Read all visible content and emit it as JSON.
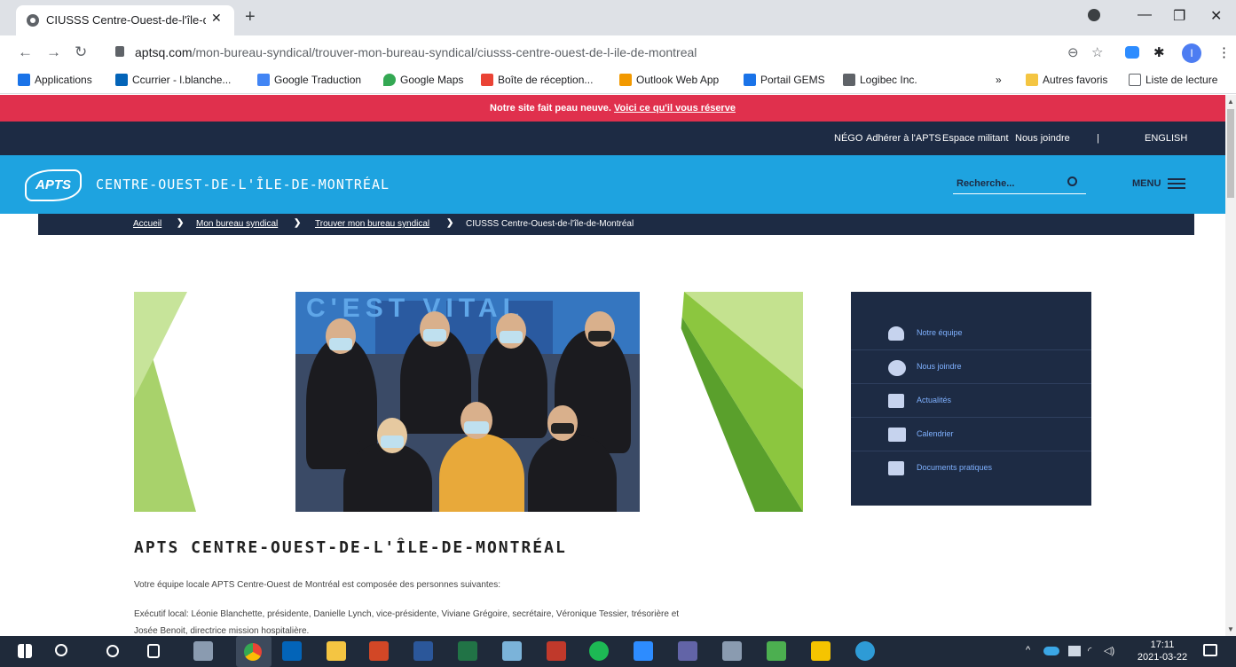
{
  "browser": {
    "tab_title": "CIUSSS Centre-Ouest-de-l'île-de-",
    "tab_close": "✕",
    "new_tab": "+",
    "url_host": "aptsq.com",
    "url_path": "/mon-bureau-syndical/trouver-mon-bureau-syndical/ciusss-centre-ouest-de-l-ile-de-montreal",
    "profile_initial": "I",
    "bookmarks": [
      {
        "label": "Applications",
        "color": "#1a73e8"
      },
      {
        "label": "Ccurrier - l.blanche...",
        "color": "#0364b8"
      },
      {
        "label": "Google Traduction",
        "color": "#4285f4"
      },
      {
        "label": "Google Maps",
        "color": "#34a853"
      },
      {
        "label": "Boîte de réception...",
        "color": "#ea4335"
      },
      {
        "label": "Outlook Web App",
        "color": "#f29900"
      },
      {
        "label": "Portail GEMS",
        "color": "#1a73e8"
      },
      {
        "label": "Logibec Inc.",
        "color": "#5f6368"
      }
    ],
    "bookmarks_more": "»",
    "other_bookmarks": "Autres favoris",
    "reading_list": "Liste de lecture"
  },
  "site": {
    "announcement_text": "Notre site fait peau neuve. ",
    "announcement_link": "Voici ce qu'il vous réserve",
    "top_links": [
      "NÉGO",
      "Adhérer à l'APTS",
      "Espace militant",
      "Nous joindre",
      "|",
      "ENGLISH"
    ],
    "logo_text": "APTS",
    "site_name": "CENTRE-OUEST-DE-L'ÎLE-DE-MONTRÉAL",
    "search_placeholder": "Recherche...",
    "menu_label": "MENU",
    "breadcrumb": [
      "Accueil",
      "Mon bureau syndical",
      "Trouver mon bureau syndical",
      "CIUSSS Centre-Ouest-de-l'île-de-Montréal"
    ],
    "breadcrumb_sep": "❯",
    "photo_banner": "C'EST VITAL",
    "sidebar": [
      {
        "label": "Notre équipe",
        "icon": "person-icon"
      },
      {
        "label": "Nous joindre",
        "icon": "info-icon"
      },
      {
        "label": "Actualités",
        "icon": "news-icon"
      },
      {
        "label": "Calendrier",
        "icon": "calendar-icon"
      },
      {
        "label": "Documents pratiques",
        "icon": "document-icon"
      }
    ],
    "page_title": "APTS CENTRE-OUEST-DE-L'ÎLE-DE-MONTRÉAL",
    "intro": "Votre équipe locale APTS Centre-Ouest de Montréal est composée des personnes suivantes:",
    "exec_line1": "Exécutif local: Léonie Blanchette, présidente, Danielle Lynch, vice-présidente, Viviane Grégoire, secrétaire, Véronique Tessier, trésorière et",
    "exec_line2": "Josée Benoit, directrice mission hospitalière."
  },
  "taskbar": {
    "time": "17:11",
    "date": "2021-03-22"
  },
  "colors": {
    "announce": "#e0304d",
    "navy": "#1d2b44",
    "brand_blue": "#1ea3e0"
  }
}
